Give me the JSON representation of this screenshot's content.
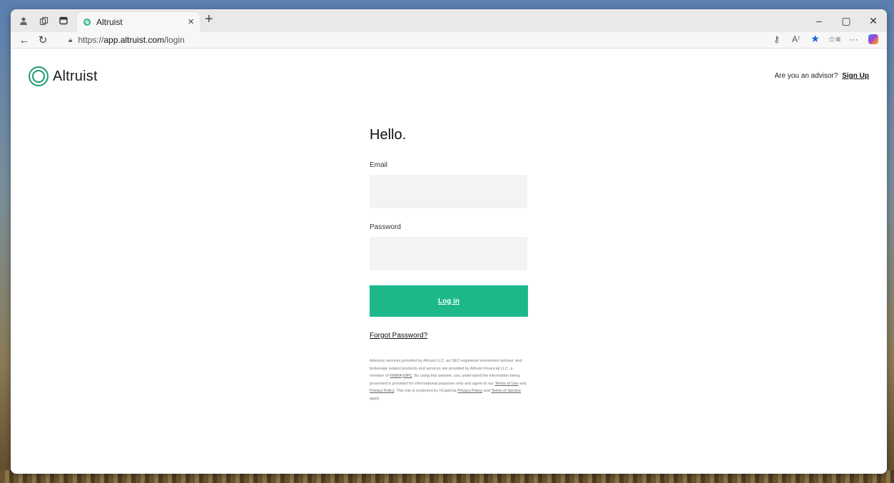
{
  "browser": {
    "tab_title": "Altruist",
    "url_prefix": "https://",
    "url_host": "app.altruist.com",
    "url_path": "/login",
    "win_minimize": "–",
    "win_maximize": "▢",
    "win_close": "✕"
  },
  "header": {
    "logo_text": "Altruist",
    "advisor_prompt": "Are you an advisor?",
    "signup_label": "Sign Up"
  },
  "login": {
    "heading": "Hello.",
    "email_label": "Email",
    "email_value": "",
    "password_label": "Password",
    "password_value": "",
    "login_button": "Log in",
    "forgot_password": "Forgot Password?"
  },
  "disclosure": {
    "part1": "Advisory services provided by Altruist LLC, an SEC-registered investment adviser, and brokerage related products and services are provided by Altruist Financial LLC, a member of ",
    "finra": "FINRA",
    "sep": "/",
    "sipc": "SIPC",
    "part2": ". By using this website, you understand the information being presented is provided for informational purposes only and agree to our ",
    "terms_of_use": "Terms of Use",
    "part3": " and ",
    "privacy_policy": "Privacy Policy",
    "part4": ". This site is protected by hCaptcha ",
    "hcaptcha_privacy": "Privacy Policy",
    "part5": " and ",
    "hcaptcha_terms": "Terms of Service",
    "part6": " apply."
  },
  "colors": {
    "brand_green": "#1cb88a",
    "logo_green": "#1f9a6e",
    "input_bg": "#f3f3f3"
  }
}
